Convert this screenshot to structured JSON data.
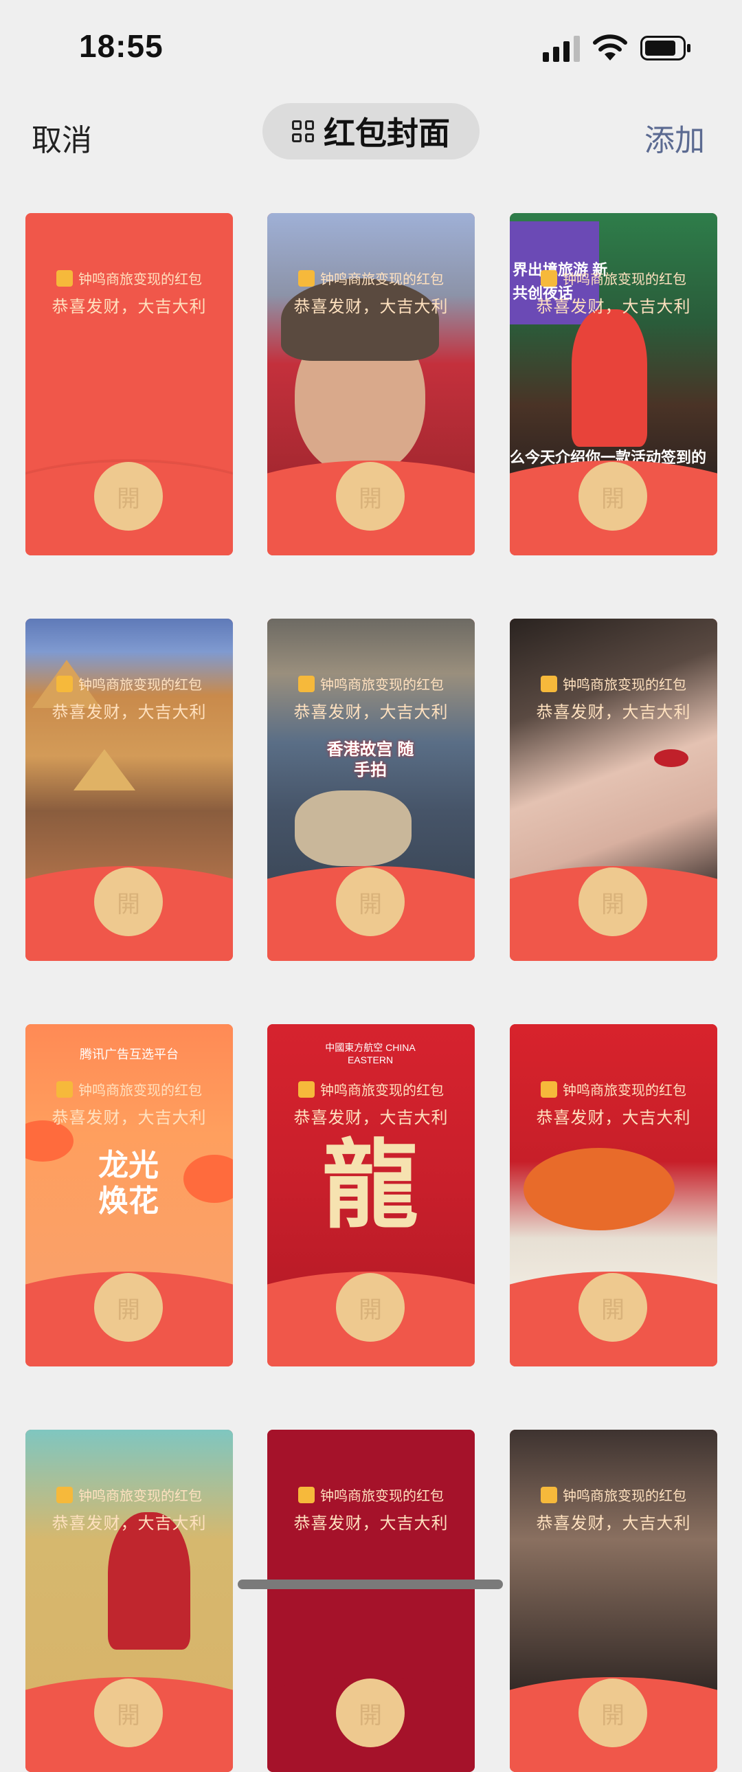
{
  "status": {
    "time": "18:55"
  },
  "nav": {
    "cancel": "取消",
    "title": "红包封面",
    "add": "添加"
  },
  "card_common": {
    "brand": "钟鸣商旅变现的红包",
    "bless": "恭喜发财，大吉大利",
    "open": "開"
  },
  "cards": [
    {
      "brand": "钟鸣商旅变现的红包",
      "bless": "恭喜发财，大吉大利",
      "open": "開"
    },
    {
      "brand": "钟鸣商旅变现的红包",
      "bless": "恭喜发财，大吉大利",
      "open": "開"
    },
    {
      "brand": "钟鸣商旅变现的红包",
      "bless": "恭喜发财，大吉大利",
      "open": "開",
      "overlay": "界出境旅游 新共创夜话",
      "overlay2": "么今天介绍你一款活动签到的"
    },
    {
      "brand": "钟鸣商旅变现的红包",
      "bless": "恭喜发财，大吉大利",
      "open": "開"
    },
    {
      "brand": "钟鸣商旅变现的红包",
      "bless": "恭喜发财，大吉大利",
      "open": "開",
      "overlay": "香港故宫 随手拍"
    },
    {
      "brand": "钟鸣商旅变现的红包",
      "bless": "恭喜发财，大吉大利",
      "open": "開"
    },
    {
      "brand": "钟鸣商旅变现的红包",
      "bless": "恭喜发财，大吉大利",
      "open": "開",
      "top_label": "腾讯广告互选平台",
      "overlay": "龙光 焕花"
    },
    {
      "brand": "钟鸣商旅变现的红包",
      "bless": "恭喜发财，大吉大利",
      "open": "開",
      "top_label": "中國東方航空 CHINA EASTERN",
      "overlay": "龍"
    },
    {
      "brand": "钟鸣商旅变现的红包",
      "bless": "恭喜发财，大吉大利",
      "open": "開"
    },
    {
      "brand": "钟鸣商旅变现的红包",
      "bless": "恭喜发财，大吉大利",
      "open": "開"
    },
    {
      "brand": "钟鸣商旅变现的红包",
      "bless": "恭喜发财，大吉大利",
      "open": "開"
    },
    {
      "brand": "钟鸣商旅变现的红包",
      "bless": "恭喜发财，大吉大利",
      "open": "開"
    }
  ],
  "colors": {
    "red": "#f0574a",
    "gold": "#eec98f",
    "bg": "#efefef",
    "link": "#5b6a91"
  },
  "icons": [
    "signal-icon",
    "wifi-icon",
    "battery-icon",
    "grid-icon"
  ]
}
